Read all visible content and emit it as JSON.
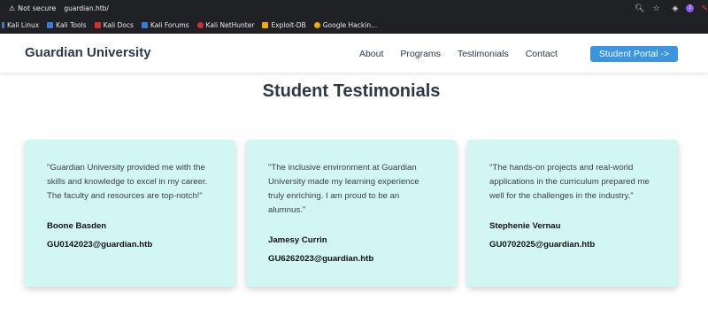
{
  "browser": {
    "security_label": "Not secure",
    "url": "guardian.htb/",
    "extension_badge": "2",
    "bookmarks": [
      {
        "label": "Kali Linux",
        "color": "#3a7bd5"
      },
      {
        "label": "Kali Tools",
        "color": "#3a7bd5"
      },
      {
        "label": "Kali Docs",
        "color": "#d32f2f"
      },
      {
        "label": "Kali Forums",
        "color": "#3a7bd5"
      },
      {
        "label": "Kali NetHunter",
        "color": "#d32f2f"
      },
      {
        "label": "Exploit-DB",
        "color": "#f2a900"
      },
      {
        "label": "Google Hackin...",
        "color": "#f2a900"
      }
    ]
  },
  "header": {
    "brand": "Guardian University",
    "nav": [
      "About",
      "Programs",
      "Testimonials",
      "Contact"
    ],
    "portal_button": "Student Portal ->"
  },
  "main": {
    "title": "Student Testimonials",
    "testimonials": [
      {
        "quote": "\"Guardian University provided me with the skills and knowledge to excel in my career. The faculty and resources are top-notch!\"",
        "name": "Boone Basden",
        "email": "GU0142023@guardian.htb"
      },
      {
        "quote": "\"The inclusive environment at Guardian University made my learning experience truly enriching. I am proud to be an alumnus.\"",
        "name": "Jamesy Currin",
        "email": "GU6262023@guardian.htb"
      },
      {
        "quote": "\"The hands-on projects and real-world applications in the curriculum prepared me well for the challenges in the industry.\"",
        "name": "Stephenie Vernau",
        "email": "GU0702025@guardian.htb"
      }
    ]
  },
  "colors": {
    "card_bg": "#d2f7f3",
    "accent": "#3b95e0",
    "heading": "#2d3748"
  }
}
